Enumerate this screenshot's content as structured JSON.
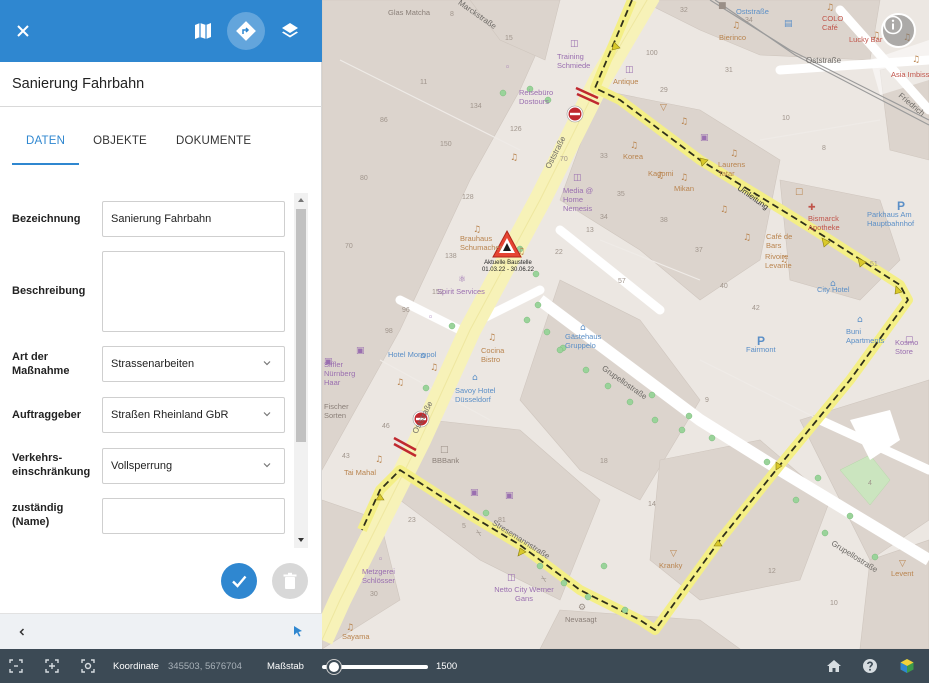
{
  "panel": {
    "title": "Sanierung Fahrbahn",
    "tabs": [
      {
        "label": "DATEN",
        "active": true
      },
      {
        "label": "OBJEKTE",
        "active": false
      },
      {
        "label": "DOKUMENTE",
        "active": false
      }
    ],
    "fields": [
      {
        "label": "Bezeichnung",
        "value": "Sanierung Fahrbahn",
        "type": "text"
      },
      {
        "label": "Beschreibung",
        "value": "",
        "type": "textarea"
      },
      {
        "label": "Art der Maßnahme",
        "value": "Strassenarbeiten",
        "type": "select"
      },
      {
        "label": "Auftraggeber",
        "value": "Straßen Rheinland GbR",
        "type": "select"
      },
      {
        "label": "Verkehrs-einschränkung",
        "value": "Vollsperrung",
        "type": "select"
      },
      {
        "label": "zuständig (Name)",
        "value": "",
        "type": "text"
      }
    ]
  },
  "map": {
    "marker_label_line1": "Aktuelle Baustelle",
    "marker_label_line2": "01.03.22 - 30.06.22",
    "streets": {
      "oststrasse_1": "Oststraße",
      "oststrasse_2": "Oststraße",
      "oststrasse_top": "Oststraße",
      "umleitung": "Umleitung",
      "grupellostrasse_1": "Grupellostraße",
      "grupellostrasse_2": "Grupellostraße",
      "stresemannstrasse": "Stresemannstraße",
      "friedrich": "Friedrich",
      "marckstrasse": "Marckstraße"
    },
    "pois": {
      "glas_matcha": "Glas Matcha",
      "training_schmiede": "Training Schmiede",
      "reisebuero": "Reisebüro Dostours",
      "antique": "Antique",
      "korea": "Korea",
      "kagomi": "Kagomi",
      "mikan": "Mikan",
      "laurens": "Laurens Tatar",
      "media_home": "Media @ Home Nemesis",
      "braeuhaus": "Brauhaus Schumacher",
      "spirit": "Spirit Services",
      "cafe_de_bars": "Café de Bars",
      "rivoire": "Rivoire Levante",
      "bismarck": "Bismarck Apotheke",
      "parkhaus": "Parkhaus Am Hauptbahnhof",
      "city_hotel": "City Hotel",
      "buni": "Buni Apartments",
      "kosmo": "Kosmo Store",
      "gaesthaus": "Gästehaus Gruppelo",
      "fairmont": "Fairmont",
      "hotel_monopol": "Hotel Monopol",
      "cocina": "Cocina Bistro",
      "savoy": "Savoy Hotel Düsseldorf",
      "bbbank": "BBBank",
      "tai_mahal": "Tai Mahal",
      "siffler": "Siffler Nürnberg Haar",
      "fischer": "Fischer Sorten",
      "metzgerei": "Metzgerei Schlösser",
      "netto": "Netto City Werner Gans",
      "nevasagt": "Nevasagt",
      "kranky": "Kranky",
      "levent": "Levent",
      "sayama": "Sayama",
      "oststrasse_stop": "Oststraße",
      "beenso": "Bierinco",
      "colo": "COLO Café",
      "lucky": "Lucky Bar",
      "asia": "Asia Imbiss"
    }
  },
  "bottombar": {
    "koordinate_label": "Koordinate",
    "koordinate_value": "345503, 5676704",
    "massstab_label": "Maßstab",
    "massstab_value": "1500",
    "scale_slider_fraction": 0.05
  },
  "colors": {
    "primary": "#2f87d0",
    "bottombar": "#3c4a55",
    "detour_yellow": "#f3ee8a",
    "detour_line": "#2f2f1a",
    "closure_red": "#c0292f"
  },
  "icons": {
    "close": "close-icon",
    "map": "map-icon",
    "directions": "directions-icon",
    "layers": "layers-icon",
    "check": "check-icon",
    "trash": "trash-icon",
    "back": "chevron-left-icon",
    "pointer": "pointer-icon",
    "info": "info-icon",
    "home": "home-icon",
    "help": "help-icon",
    "app": "app-logo-icon"
  }
}
